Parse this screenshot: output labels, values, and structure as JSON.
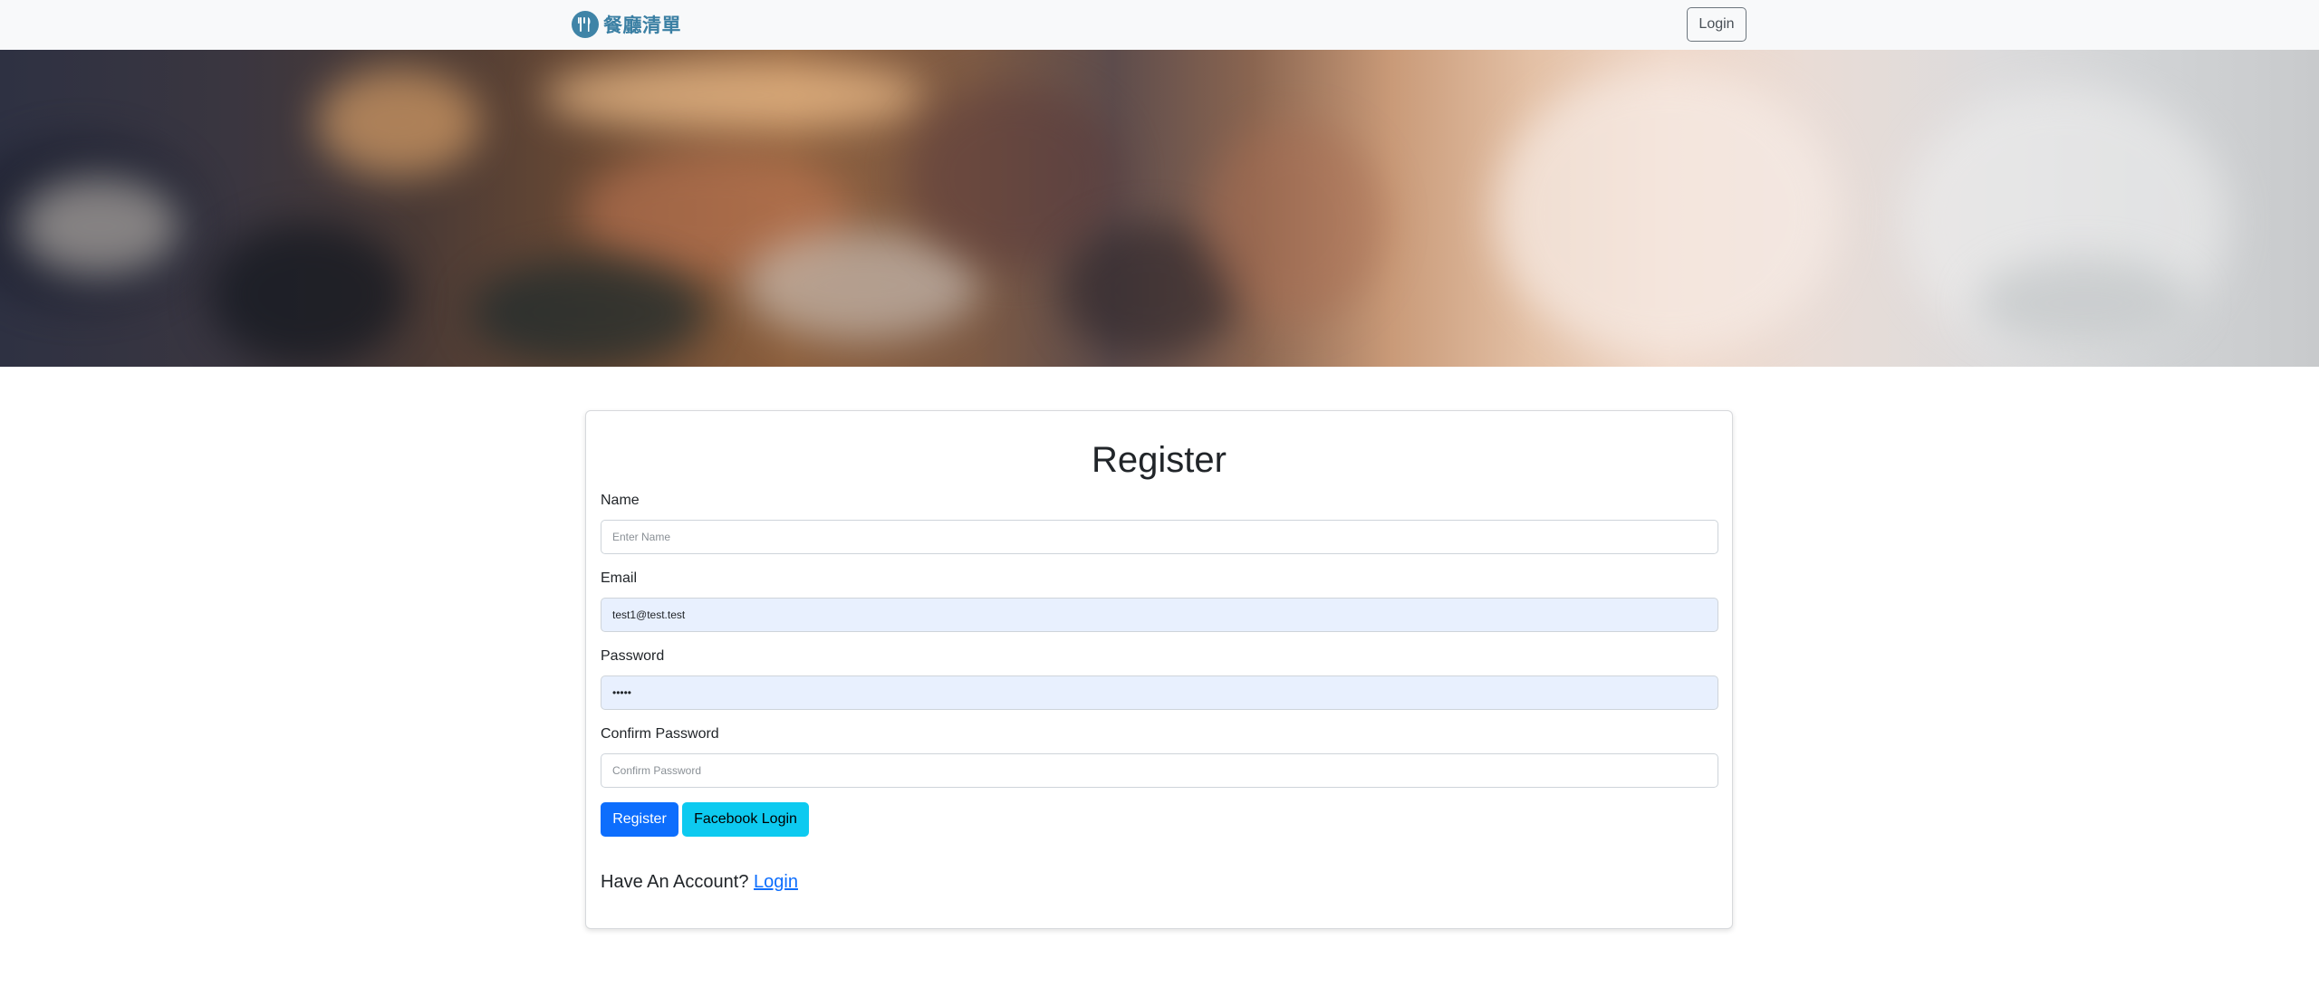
{
  "navbar": {
    "brand_text": "餐廳清單",
    "brand_icon": "fork-knife-icon",
    "login_label": "Login"
  },
  "hero": {
    "image": "blurred-restaurant-interior"
  },
  "form": {
    "title": "Register",
    "name": {
      "label": "Name",
      "value": "",
      "placeholder": "Enter Name"
    },
    "email": {
      "label": "Email",
      "value": "test1@test.test",
      "placeholder": ""
    },
    "password": {
      "label": "Password",
      "value": "•••••",
      "placeholder": ""
    },
    "confirm_password": {
      "label": "Confirm Password",
      "value": "",
      "placeholder": "Confirm Password"
    },
    "register_label": "Register",
    "facebook_label": "Facebook Login",
    "have_account_text": "Have An Account?",
    "login_link_label": "Login"
  },
  "colors": {
    "brand": "#3a7fa3",
    "primary": "#0d6efd",
    "info": "#0dcaf0",
    "autofill": "#e8f0fe"
  }
}
